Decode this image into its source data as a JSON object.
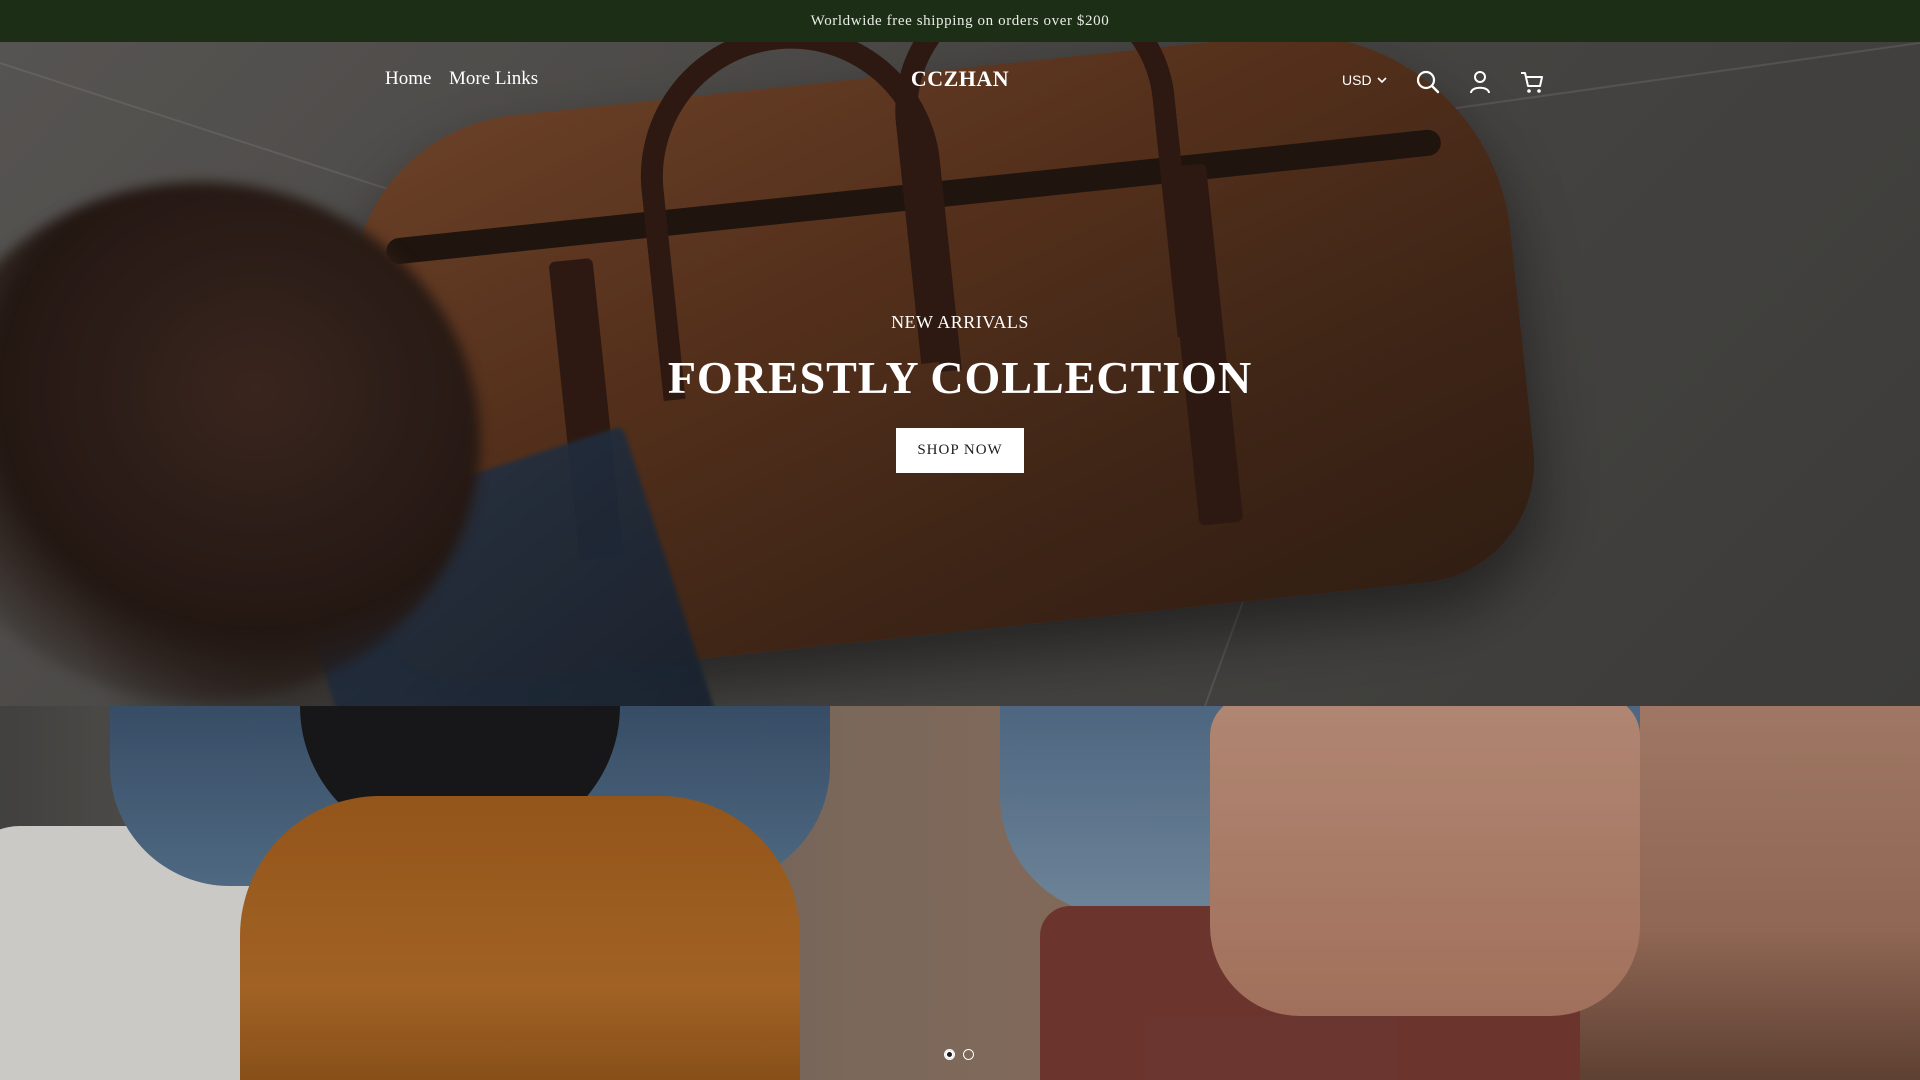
{
  "announcement": {
    "text": "Worldwide free shipping on orders over $200"
  },
  "header": {
    "nav": [
      {
        "label": "Home"
      },
      {
        "label": "More Links"
      }
    ],
    "logo": "CCZHAN",
    "currency": "USD",
    "icons": [
      "search-icon",
      "account-icon",
      "cart-icon"
    ]
  },
  "hero": {
    "eyebrow": "NEW ARRIVALS",
    "headline": "FORESTLY COLLECTION",
    "cta_label": "SHOP NOW"
  },
  "slideshow": {
    "slide_count": 2,
    "active_index": 0
  },
  "colors": {
    "announcement_bg": "#1d2e17",
    "button_bg": "#ffffff",
    "text_on_hero": "#ffffff"
  }
}
